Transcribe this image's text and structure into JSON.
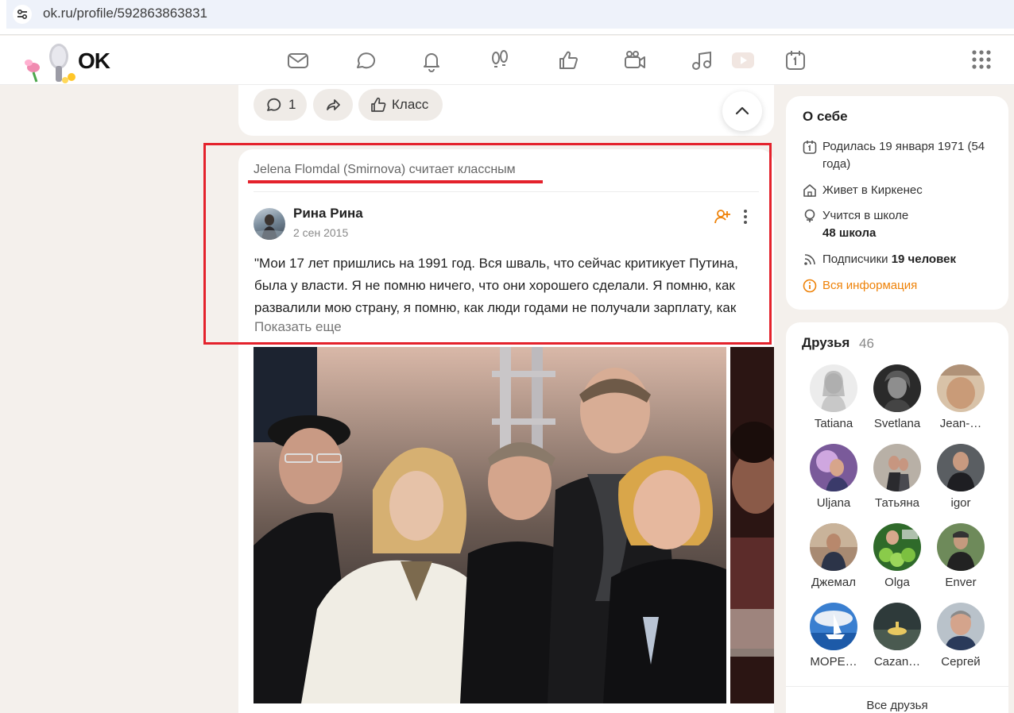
{
  "browser": {
    "url": "ok.ru/profile/592863863831"
  },
  "header": {
    "logo_text": "OK",
    "nav_icons": [
      "mail-icon",
      "chat-icon",
      "bell-icon",
      "guests-footprints-icon",
      "like-thumb-icon",
      "video-camera-icon",
      "music-note-icon",
      "video-play-icon",
      "calendar-icon"
    ],
    "apps_icon": "apps-grid-icon"
  },
  "previous_post": {
    "comments_count": "1",
    "class_label": "Класс"
  },
  "post": {
    "liked_by_line": "Jelena Flomdal (Smirnova) считает классным",
    "author": "Рина Рина",
    "date": "2 сен 2015",
    "text": "\"Мои 17 лет пришлись на 1991 год. Вся шваль, что сейчас критикует Путина, была у власти. Я не помню ничего, что они хорошего сделали. Я помню, как развалили мою страну, я помню, как люди годами не получали зарплату, как",
    "show_more": "Показать еще"
  },
  "about": {
    "title": "О себе",
    "born": "Родилась 19 января 1971 (54 года)",
    "lives": "Живет в Киркенес",
    "school_prefix": "Учится в школе",
    "school_name": "48 школа",
    "subscribers_prefix": "Подписчики",
    "subscribers_value": "19 человек",
    "all_info": "Вся информация"
  },
  "friends": {
    "title": "Друзья",
    "count": "46",
    "items": [
      {
        "name": "Tatiana"
      },
      {
        "name": "Svetlana"
      },
      {
        "name": "Jean-…"
      },
      {
        "name": "Uljana"
      },
      {
        "name": "Татьяна"
      },
      {
        "name": "igor"
      },
      {
        "name": "Джемал"
      },
      {
        "name": "Olga"
      },
      {
        "name": "Enver"
      },
      {
        "name": "МОРЕ…"
      },
      {
        "name": "Cazan…"
      },
      {
        "name": "Сергей"
      }
    ],
    "all_label": "Все друзья"
  },
  "colors": {
    "accent_orange": "#ee8208",
    "highlight_red": "#e4222c",
    "page_bg": "#f4f0ec"
  }
}
